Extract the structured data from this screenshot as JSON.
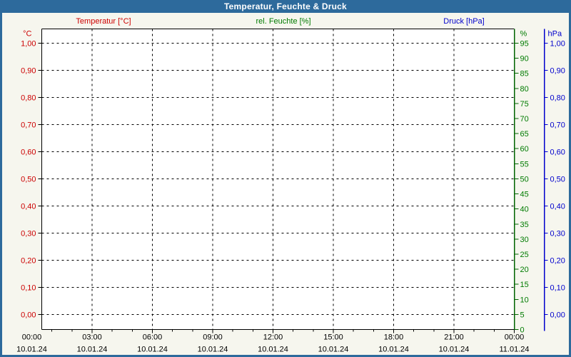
{
  "window": {
    "title": "Temperatur, Feuchte & Druck"
  },
  "colors": {
    "titlebar": "#2d6a9c",
    "title_text": "#ffffff",
    "window_border": "#2d6a9c",
    "background": "#f6f6ee",
    "plot_background": "#ffffff",
    "temperature": "#cc0000",
    "humidity": "#007b00",
    "humidity_axis_line": "#006400",
    "pressure": "#0000cc",
    "grid": "#000000",
    "axis": "#000000",
    "x_label_text": "#000000"
  },
  "chart_data": {
    "type": "line",
    "title": "Temperatur, Feuchte & Druck",
    "grid": "dashed",
    "series": [
      {
        "name": "Temperatur [°C]",
        "color_key": "temperature",
        "unit": "°C",
        "values": []
      },
      {
        "name": "rel. Feuchte [%]",
        "color_key": "humidity",
        "unit": "%",
        "values": []
      },
      {
        "name": "Druck [hPa]",
        "color_key": "pressure",
        "unit": "hPa",
        "values": []
      }
    ],
    "y_axis_left": {
      "unit": "°C",
      "color_key": "temperature",
      "range": [
        0.0,
        1.0
      ],
      "tick_labels": [
        "1,00",
        "0,90",
        "0,80",
        "0,70",
        "0,60",
        "0,50",
        "0,40",
        "0,30",
        "0,20",
        "0,10",
        "0,00"
      ]
    },
    "y_axis_right_inner": {
      "unit": "%",
      "color_key": "humidity",
      "range": [
        0,
        95
      ],
      "tick_labels": [
        "95",
        "90",
        "85",
        "80",
        "75",
        "70",
        "65",
        "60",
        "55",
        "50",
        "45",
        "40",
        "35",
        "30",
        "25",
        "20",
        "15",
        "10",
        "5",
        "0"
      ]
    },
    "y_axis_right_outer": {
      "unit": "hPa",
      "color_key": "pressure",
      "range": [
        0.0,
        1.0
      ],
      "tick_labels": [
        "1,00",
        "0,90",
        "0,80",
        "0,70",
        "0,60",
        "0,50",
        "0,40",
        "0,30",
        "0,20",
        "0,10",
        "0,00"
      ]
    },
    "x_axis": {
      "minor_ticks_per_interval": 2,
      "major_ticks": [
        {
          "time": "00:00",
          "date": "10.01.24"
        },
        {
          "time": "03:00",
          "date": "10.01.24"
        },
        {
          "time": "06:00",
          "date": "10.01.24"
        },
        {
          "time": "09:00",
          "date": "10.01.24"
        },
        {
          "time": "12:00",
          "date": "10.01.24"
        },
        {
          "time": "15:00",
          "date": "10.01.24"
        },
        {
          "time": "18:00",
          "date": "10.01.24"
        },
        {
          "time": "21:00",
          "date": "10.01.24"
        },
        {
          "time": "00:00",
          "date": "11.01.24"
        }
      ]
    }
  }
}
